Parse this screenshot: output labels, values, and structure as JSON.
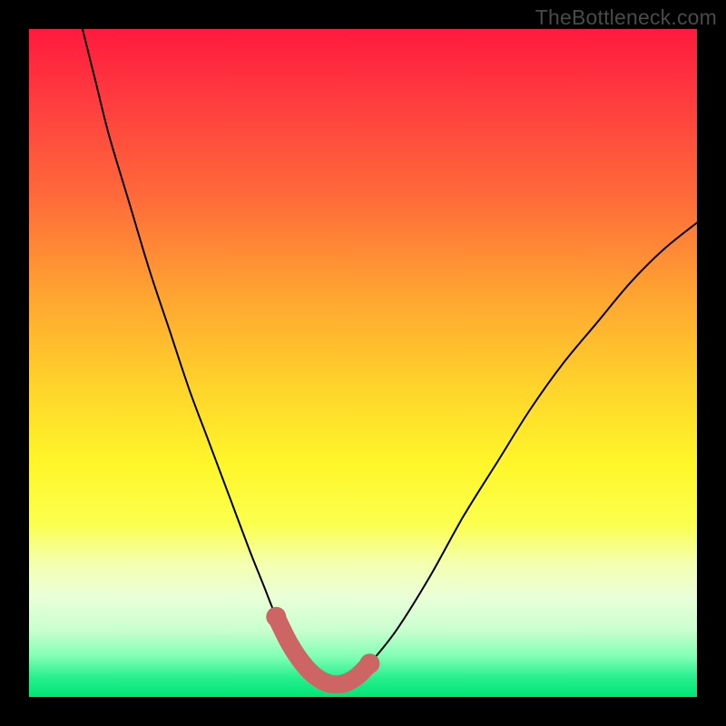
{
  "watermark": "TheBottleneck.com",
  "colors": {
    "frame": "#000000",
    "curve_thin": "#000000",
    "curve_fat": "#cc6563",
    "gradient_top": "#ff1a3e",
    "gradient_bottom": "#00e576"
  },
  "chart_data": {
    "type": "line",
    "title": "",
    "xlabel": "",
    "ylabel": "",
    "xlim": [
      0,
      100
    ],
    "ylim": [
      0,
      100
    ],
    "grid": false,
    "series": [
      {
        "name": "bottleneck-curve",
        "x": [
          8,
          10,
          12,
          15,
          18,
          21,
          24,
          27,
          30,
          33,
          35,
          37,
          39,
          41,
          43,
          45,
          47,
          49,
          51,
          55,
          60,
          65,
          70,
          75,
          80,
          85,
          90,
          95,
          100
        ],
        "y": [
          100,
          92,
          84,
          74,
          64,
          55,
          46,
          38,
          30,
          22,
          17,
          12,
          8,
          5,
          3,
          2,
          2,
          3,
          5,
          10,
          18,
          27,
          35,
          43,
          50,
          56,
          62,
          67,
          71
        ]
      }
    ],
    "annotations": [
      {
        "name": "optimal-band",
        "type": "highlight-segment",
        "x_start": 37,
        "x_end": 51,
        "note": "thick salmon overlay near minimum"
      }
    ]
  }
}
